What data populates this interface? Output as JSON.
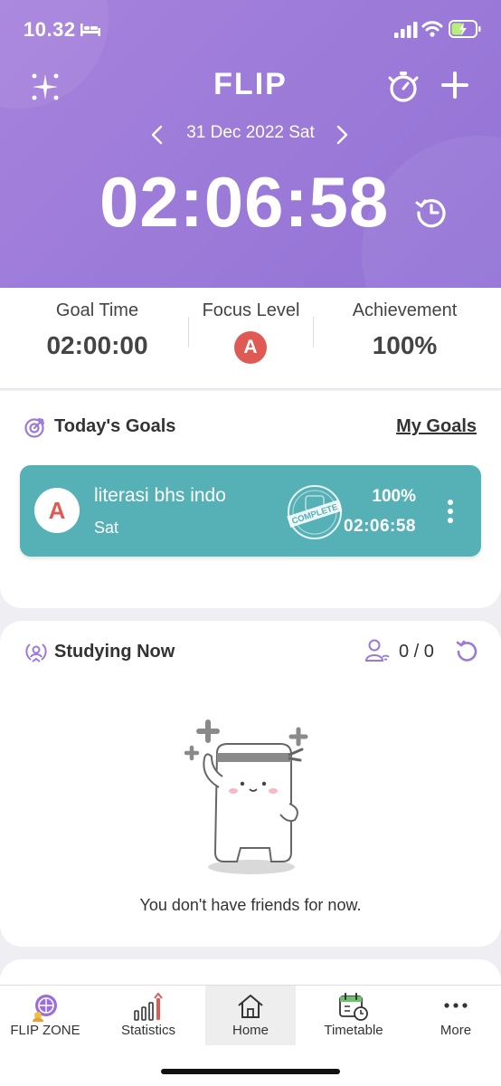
{
  "status_bar": {
    "time": "10.32"
  },
  "header": {
    "logo": "FLIP",
    "date": "31 Dec 2022 Sat",
    "elapsed_time": "02:06:58"
  },
  "stats": {
    "goal_time_label": "Goal Time",
    "goal_time_value": "02:00:00",
    "focus_level_label": "Focus Level",
    "focus_level_value": "A",
    "achievement_label": "Achievement",
    "achievement_value": "100%"
  },
  "goals": {
    "title": "Today's Goals",
    "link": "My Goals",
    "items": [
      {
        "badge": "A",
        "name": "literasi bhs indo",
        "day": "Sat",
        "percent": "100%",
        "time": "02:06:58",
        "stamp": "COMPLETE"
      }
    ]
  },
  "studying": {
    "title": "Studying Now",
    "count": "0 / 0",
    "empty_message": "You don't have friends for now."
  },
  "tabs": [
    {
      "label": "FLIP ZONE",
      "icon": "flip-zone-icon"
    },
    {
      "label": "Statistics",
      "icon": "statistics-icon"
    },
    {
      "label": "Home",
      "icon": "home-icon",
      "active": true
    },
    {
      "label": "Timetable",
      "icon": "timetable-icon"
    },
    {
      "label": "More",
      "icon": "more-icon"
    }
  ],
  "colors": {
    "header_purple": "#a682dc",
    "goal_card_teal": "#56b1b6",
    "focus_badge_red": "#e05a55",
    "accent_purple": "#9b7ad8"
  }
}
